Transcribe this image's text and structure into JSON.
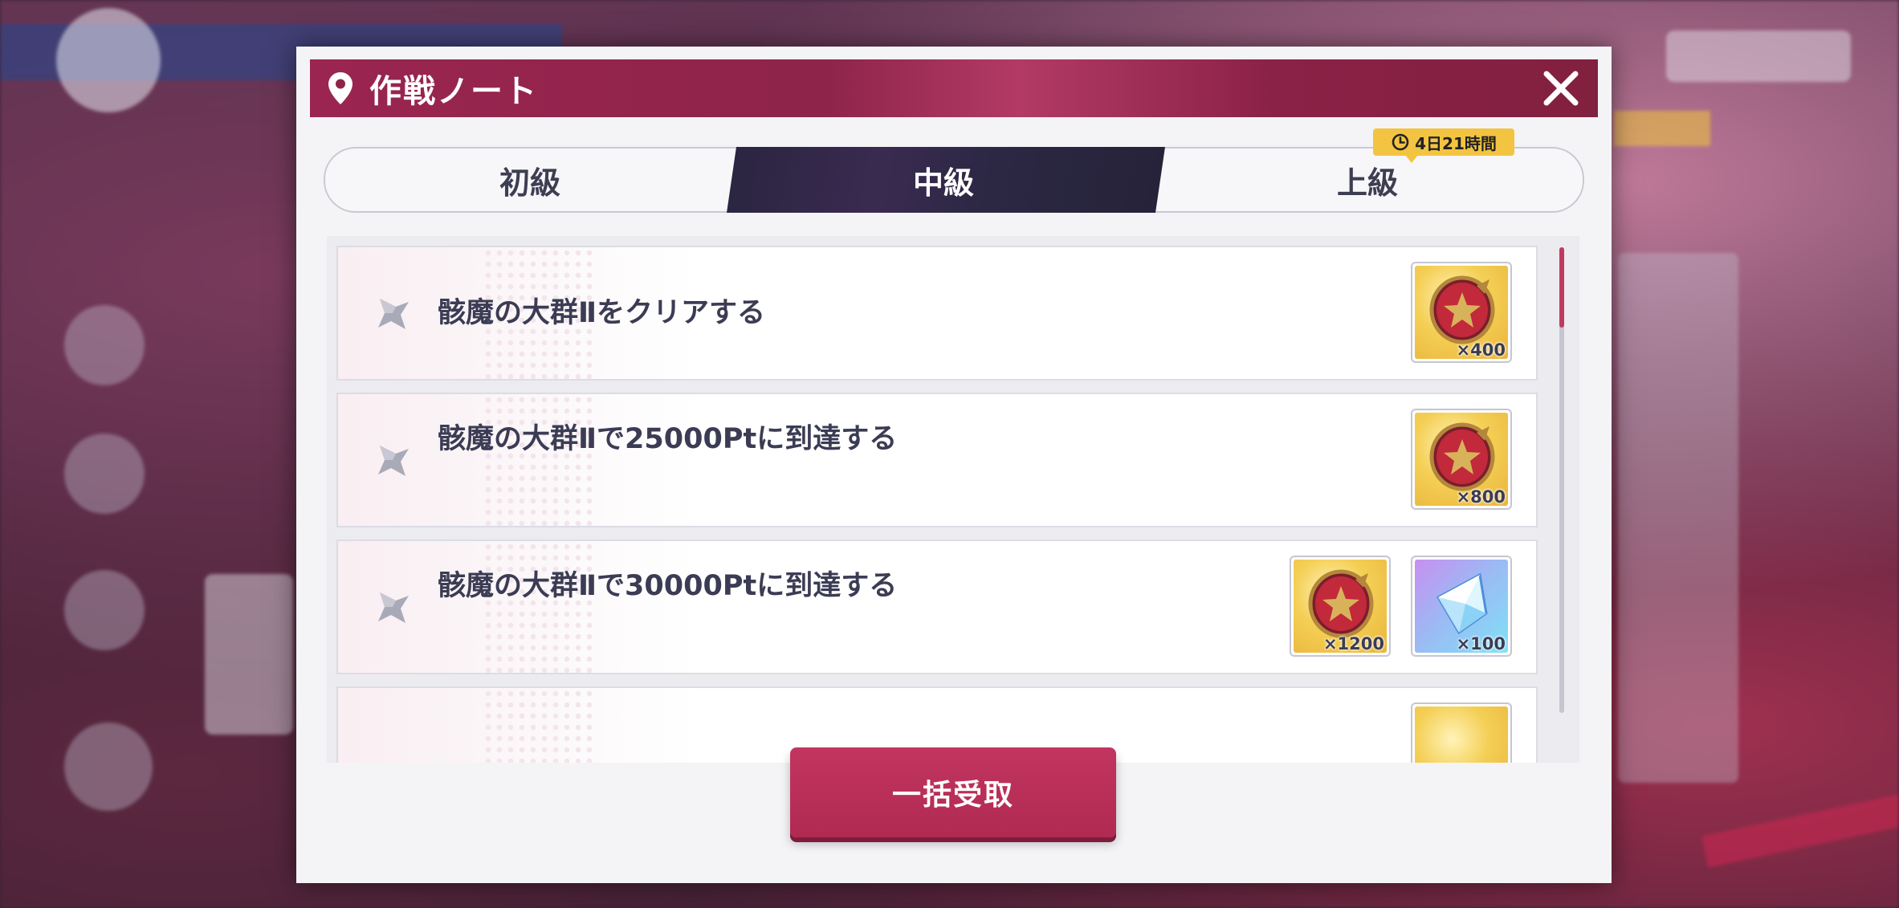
{
  "window": {
    "title": "作戦ノート"
  },
  "tabs": [
    {
      "label": "初級",
      "active": false
    },
    {
      "label": "中級",
      "active": true
    },
    {
      "label": "上級",
      "active": false
    }
  ],
  "timer": {
    "text": "4日21時間",
    "icon": "clock-icon"
  },
  "missions": [
    {
      "text": "骸魔の大群Ⅱをクリアする",
      "rewards": [
        {
          "icon": "medal-icon",
          "qty": "×400"
        }
      ]
    },
    {
      "text": "骸魔の大群Ⅱで25000Ptに到達する",
      "rewards": [
        {
          "icon": "medal-icon",
          "qty": "×800"
        }
      ]
    },
    {
      "text": "骸魔の大群Ⅱで30000Ptに到達する",
      "rewards": [
        {
          "icon": "medal-icon",
          "qty": "×1200"
        },
        {
          "icon": "crystal-icon",
          "qty": "×100"
        }
      ]
    }
  ],
  "footer": {
    "claim_all_label": "一括受取"
  },
  "colors": {
    "header": "#8e2449",
    "accent": "#c0395f",
    "active_tab": "#2a2540",
    "badge": "#f3c442",
    "text": "#3b3c54"
  }
}
